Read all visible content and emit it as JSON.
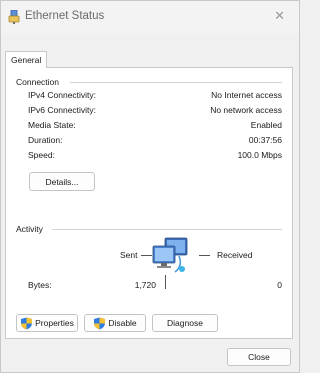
{
  "window": {
    "title": "Ethernet Status",
    "close_glyph": "✕"
  },
  "tabs": [
    {
      "label": "General"
    }
  ],
  "connection": {
    "header": "Connection",
    "rows": [
      {
        "label": "IPv4 Connectivity:",
        "value": "No Internet access"
      },
      {
        "label": "IPv6 Connectivity:",
        "value": "No network access"
      },
      {
        "label": "Media State:",
        "value": "Enabled"
      },
      {
        "label": "Duration:",
        "value": "00:37:56"
      },
      {
        "label": "Speed:",
        "value": "100.0 Mbps"
      }
    ],
    "details_button": "Details..."
  },
  "activity": {
    "header": "Activity",
    "sent_label": "Sent",
    "received_label": "Received",
    "bytes_label": "Bytes:",
    "bytes_sent": "1,720",
    "bytes_received": "0",
    "icon": "network-computers-icon"
  },
  "buttons": {
    "properties": "Properties",
    "disable": "Disable",
    "diagnose": "Diagnose",
    "close": "Close"
  },
  "colors": {
    "shield_blue": "#2f7be0",
    "shield_yellow": "#f2c230",
    "window_bg": "#f0f0f0",
    "panel_bg": "#ffffff"
  }
}
